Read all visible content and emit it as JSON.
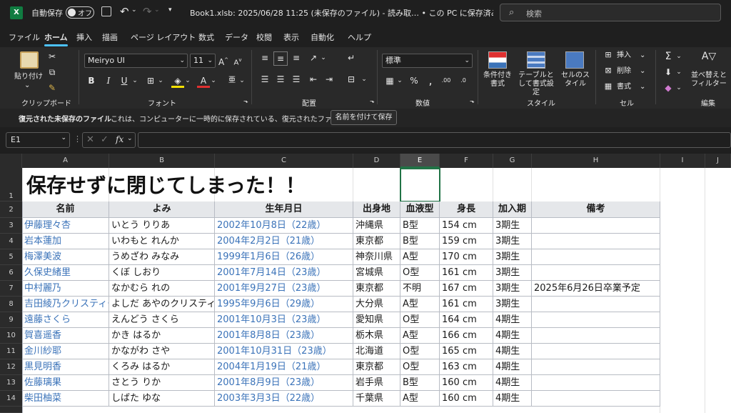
{
  "titlebar": {
    "autosave_label": "自動保存",
    "autosave_state": "オフ",
    "document_title": "Book1.xlsb: 2025/06/28 11:25 (未保存のファイル) - 読み取… • この PC に保存済み",
    "search_placeholder": "検索"
  },
  "menu_tabs": [
    "ファイル",
    "ホーム",
    "挿入",
    "描画",
    "ページ レイアウト",
    "数式",
    "データ",
    "校閲",
    "表示",
    "自動化",
    "ヘルプ"
  ],
  "active_tab": "ホーム",
  "ribbon": {
    "clipboard": {
      "label": "クリップボード",
      "paste": "貼り付け"
    },
    "font": {
      "label": "フォント",
      "family": "Meiryo UI",
      "size": "11"
    },
    "alignment": {
      "label": "配置"
    },
    "number": {
      "label": "数値",
      "format": "標準"
    },
    "styles": {
      "label": "スタイル",
      "conditional": "条件付き書式",
      "table": "テーブルとして書式設定",
      "cell_styles": "セルのスタイル"
    },
    "cells": {
      "label": "セル",
      "insert": "挿入",
      "delete": "削除",
      "format": "書式"
    },
    "editing": {
      "label": "編集",
      "sort_filter": "並べ替えとフィルター"
    }
  },
  "infobar": {
    "title": "復元された未保存のファイル",
    "message": "これは、コンピューターに一時的に保存されている、復元されたファイルです。",
    "button": "名前を付けて保存"
  },
  "formula_bar": {
    "name_box": "E1",
    "formula": ""
  },
  "sheet": {
    "columns": [
      "A",
      "B",
      "C",
      "D",
      "E",
      "F",
      "G",
      "H",
      "I",
      "J"
    ],
    "selected_column": "E",
    "title": "保存せずに閉じてしまった！！",
    "headers": [
      "名前",
      "よみ",
      "生年月日",
      "出身地",
      "血液型",
      "身長",
      "加入期",
      "備考"
    ],
    "rows": [
      [
        "伊藤理々杏",
        "いとう りりあ",
        "2002年10月8日（22歳）",
        "沖縄県",
        "B型",
        "154 cm",
        "3期生",
        ""
      ],
      [
        "岩本蓮加",
        "いわもと れんか",
        "2004年2月2日（21歳）",
        "東京都",
        "B型",
        "159 cm",
        "3期生",
        ""
      ],
      [
        "梅澤美波",
        "うめざわ みなみ",
        "1999年1月6日（26歳）",
        "神奈川県",
        "A型",
        "170 cm",
        "3期生",
        ""
      ],
      [
        "久保史緒里",
        "くぼ しおり",
        "2001年7月14日（23歳）",
        "宮城県",
        "O型",
        "161 cm",
        "3期生",
        ""
      ],
      [
        "中村麗乃",
        "なかむら れの",
        "2001年9月27日（23歳）",
        "東京都",
        "不明",
        "167 cm",
        "3期生",
        "2025年6月26日卒業予定"
      ],
      [
        "吉田綾乃クリスティー",
        "よしだ あやのクリスティー",
        "1995年9月6日（29歳）",
        "大分県",
        "A型",
        "161 cm",
        "3期生",
        ""
      ],
      [
        "遠藤さくら",
        "えんどう さくら",
        "2001年10月3日（23歳）",
        "愛知県",
        "O型",
        "164 cm",
        "4期生",
        ""
      ],
      [
        "賀喜遥香",
        "かき はるか",
        "2001年8月8日（23歳）",
        "栃木県",
        "A型",
        "166 cm",
        "4期生",
        ""
      ],
      [
        "金川紗耶",
        "かながわ さや",
        "2001年10月31日（23歳）",
        "北海道",
        "O型",
        "165 cm",
        "4期生",
        ""
      ],
      [
        "黒見明香",
        "くろみ はるか",
        "2004年1月19日（21歳）",
        "東京都",
        "O型",
        "163 cm",
        "4期生",
        ""
      ],
      [
        "佐藤璃果",
        "さとう りか",
        "2001年8月9日（23歳）",
        "岩手県",
        "B型",
        "160 cm",
        "4期生",
        ""
      ],
      [
        "柴田柚菜",
        "しばた ゆな",
        "2003年3月3日（22歳）",
        "千葉県",
        "A型",
        "160 cm",
        "4期生",
        ""
      ]
    ],
    "row_numbers": [
      "1",
      "2",
      "3",
      "4",
      "5",
      "6",
      "7",
      "8",
      "9",
      "10",
      "11",
      "12",
      "13",
      "14"
    ]
  },
  "colors": {
    "accent": "#217346",
    "link": "#3b73b9",
    "header_fill": "#e5e7ea"
  }
}
